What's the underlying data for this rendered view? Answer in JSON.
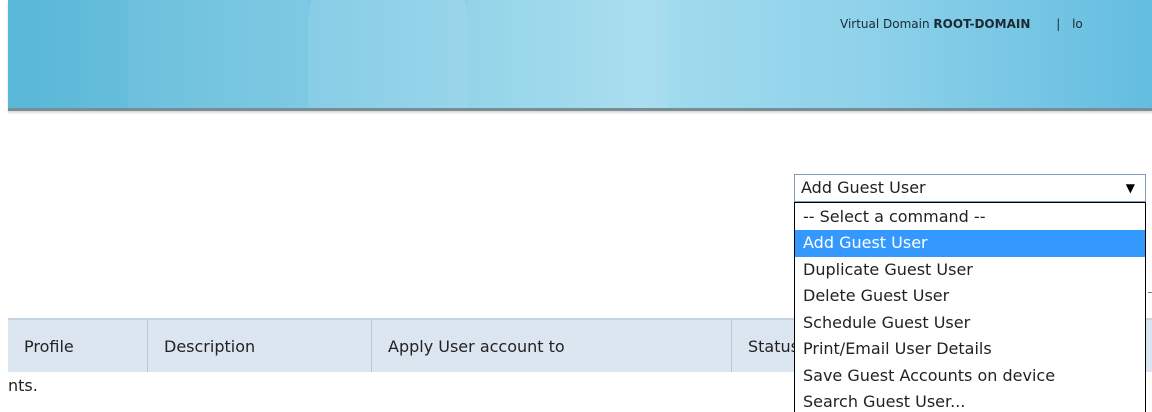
{
  "header": {
    "virtual_domain_label": "Virtual Domain",
    "domain_name": "ROOT-DOMAIN",
    "separator": "|",
    "truncated_link": "lo"
  },
  "command_select": {
    "selected": "Add Guest User",
    "options": [
      "-- Select a command --",
      "Add Guest User",
      "Duplicate Guest User",
      "Delete Guest User",
      "Schedule Guest User",
      "Print/Email User Details",
      "Save Guest Accounts on device",
      "Search Guest User..."
    ],
    "highlighted_index": 1
  },
  "table": {
    "columns": [
      "Profile",
      "Description",
      "Apply User account to",
      "Status"
    ]
  },
  "footer_text": "nts.",
  "colors": {
    "highlight": "#3399ff",
    "table_header_bg": "#dce6f1",
    "banner": "#7cc9e4"
  }
}
